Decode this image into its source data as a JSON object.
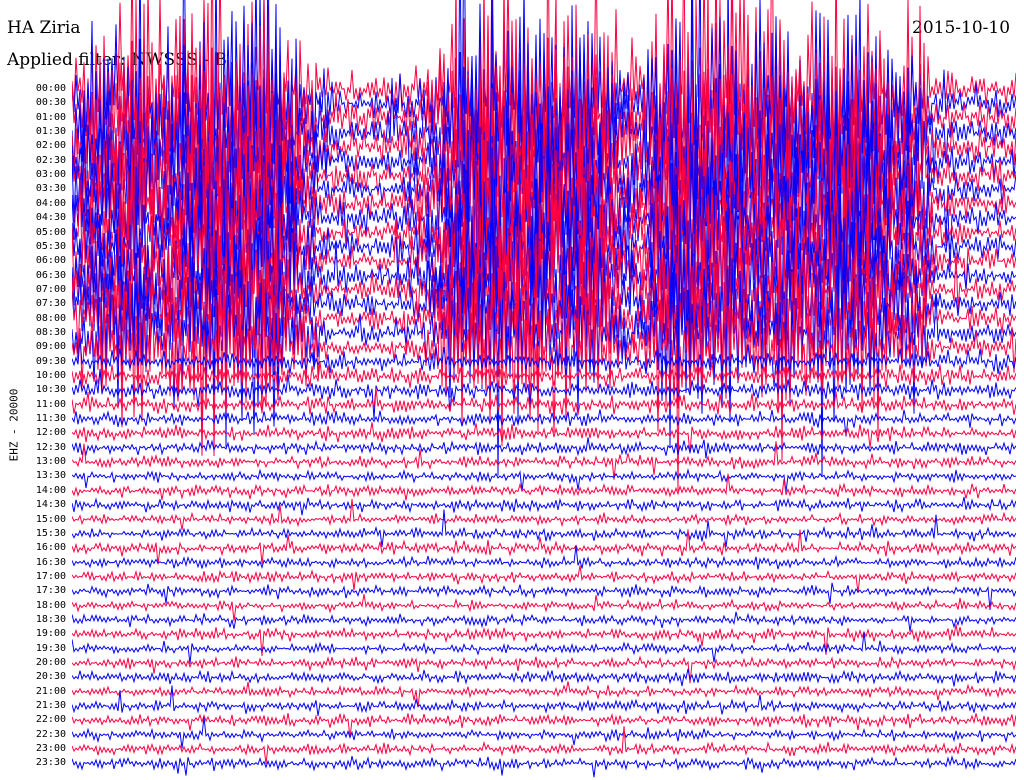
{
  "header": {
    "station": "HA Ziria",
    "date": "2015-10-10",
    "filter": "Applied filter: NWSSS - B"
  },
  "chart_data": {
    "type": "helicorder",
    "title": "HA Ziria",
    "ylabel": "EHZ - 20000",
    "row_labels": [
      "00:00",
      "00:30",
      "01:00",
      "01:30",
      "02:00",
      "02:30",
      "03:00",
      "03:30",
      "04:00",
      "04:30",
      "05:00",
      "05:30",
      "06:00",
      "06:30",
      "07:00",
      "07:30",
      "08:00",
      "08:30",
      "09:00",
      "09:30",
      "10:00",
      "10:30",
      "11:00",
      "11:30",
      "12:00",
      "12:30",
      "13:00",
      "13:30",
      "14:00",
      "14:30",
      "15:00",
      "15:30",
      "16:00",
      "16:30",
      "17:00",
      "17:30",
      "18:00",
      "18:30",
      "19:00",
      "19:30",
      "20:00",
      "20:30",
      "21:00",
      "21:30",
      "22:00",
      "22:30",
      "23:00",
      "23:30"
    ],
    "trace_colors": [
      "#ff0040",
      "#0000ff"
    ],
    "grid": false
  }
}
